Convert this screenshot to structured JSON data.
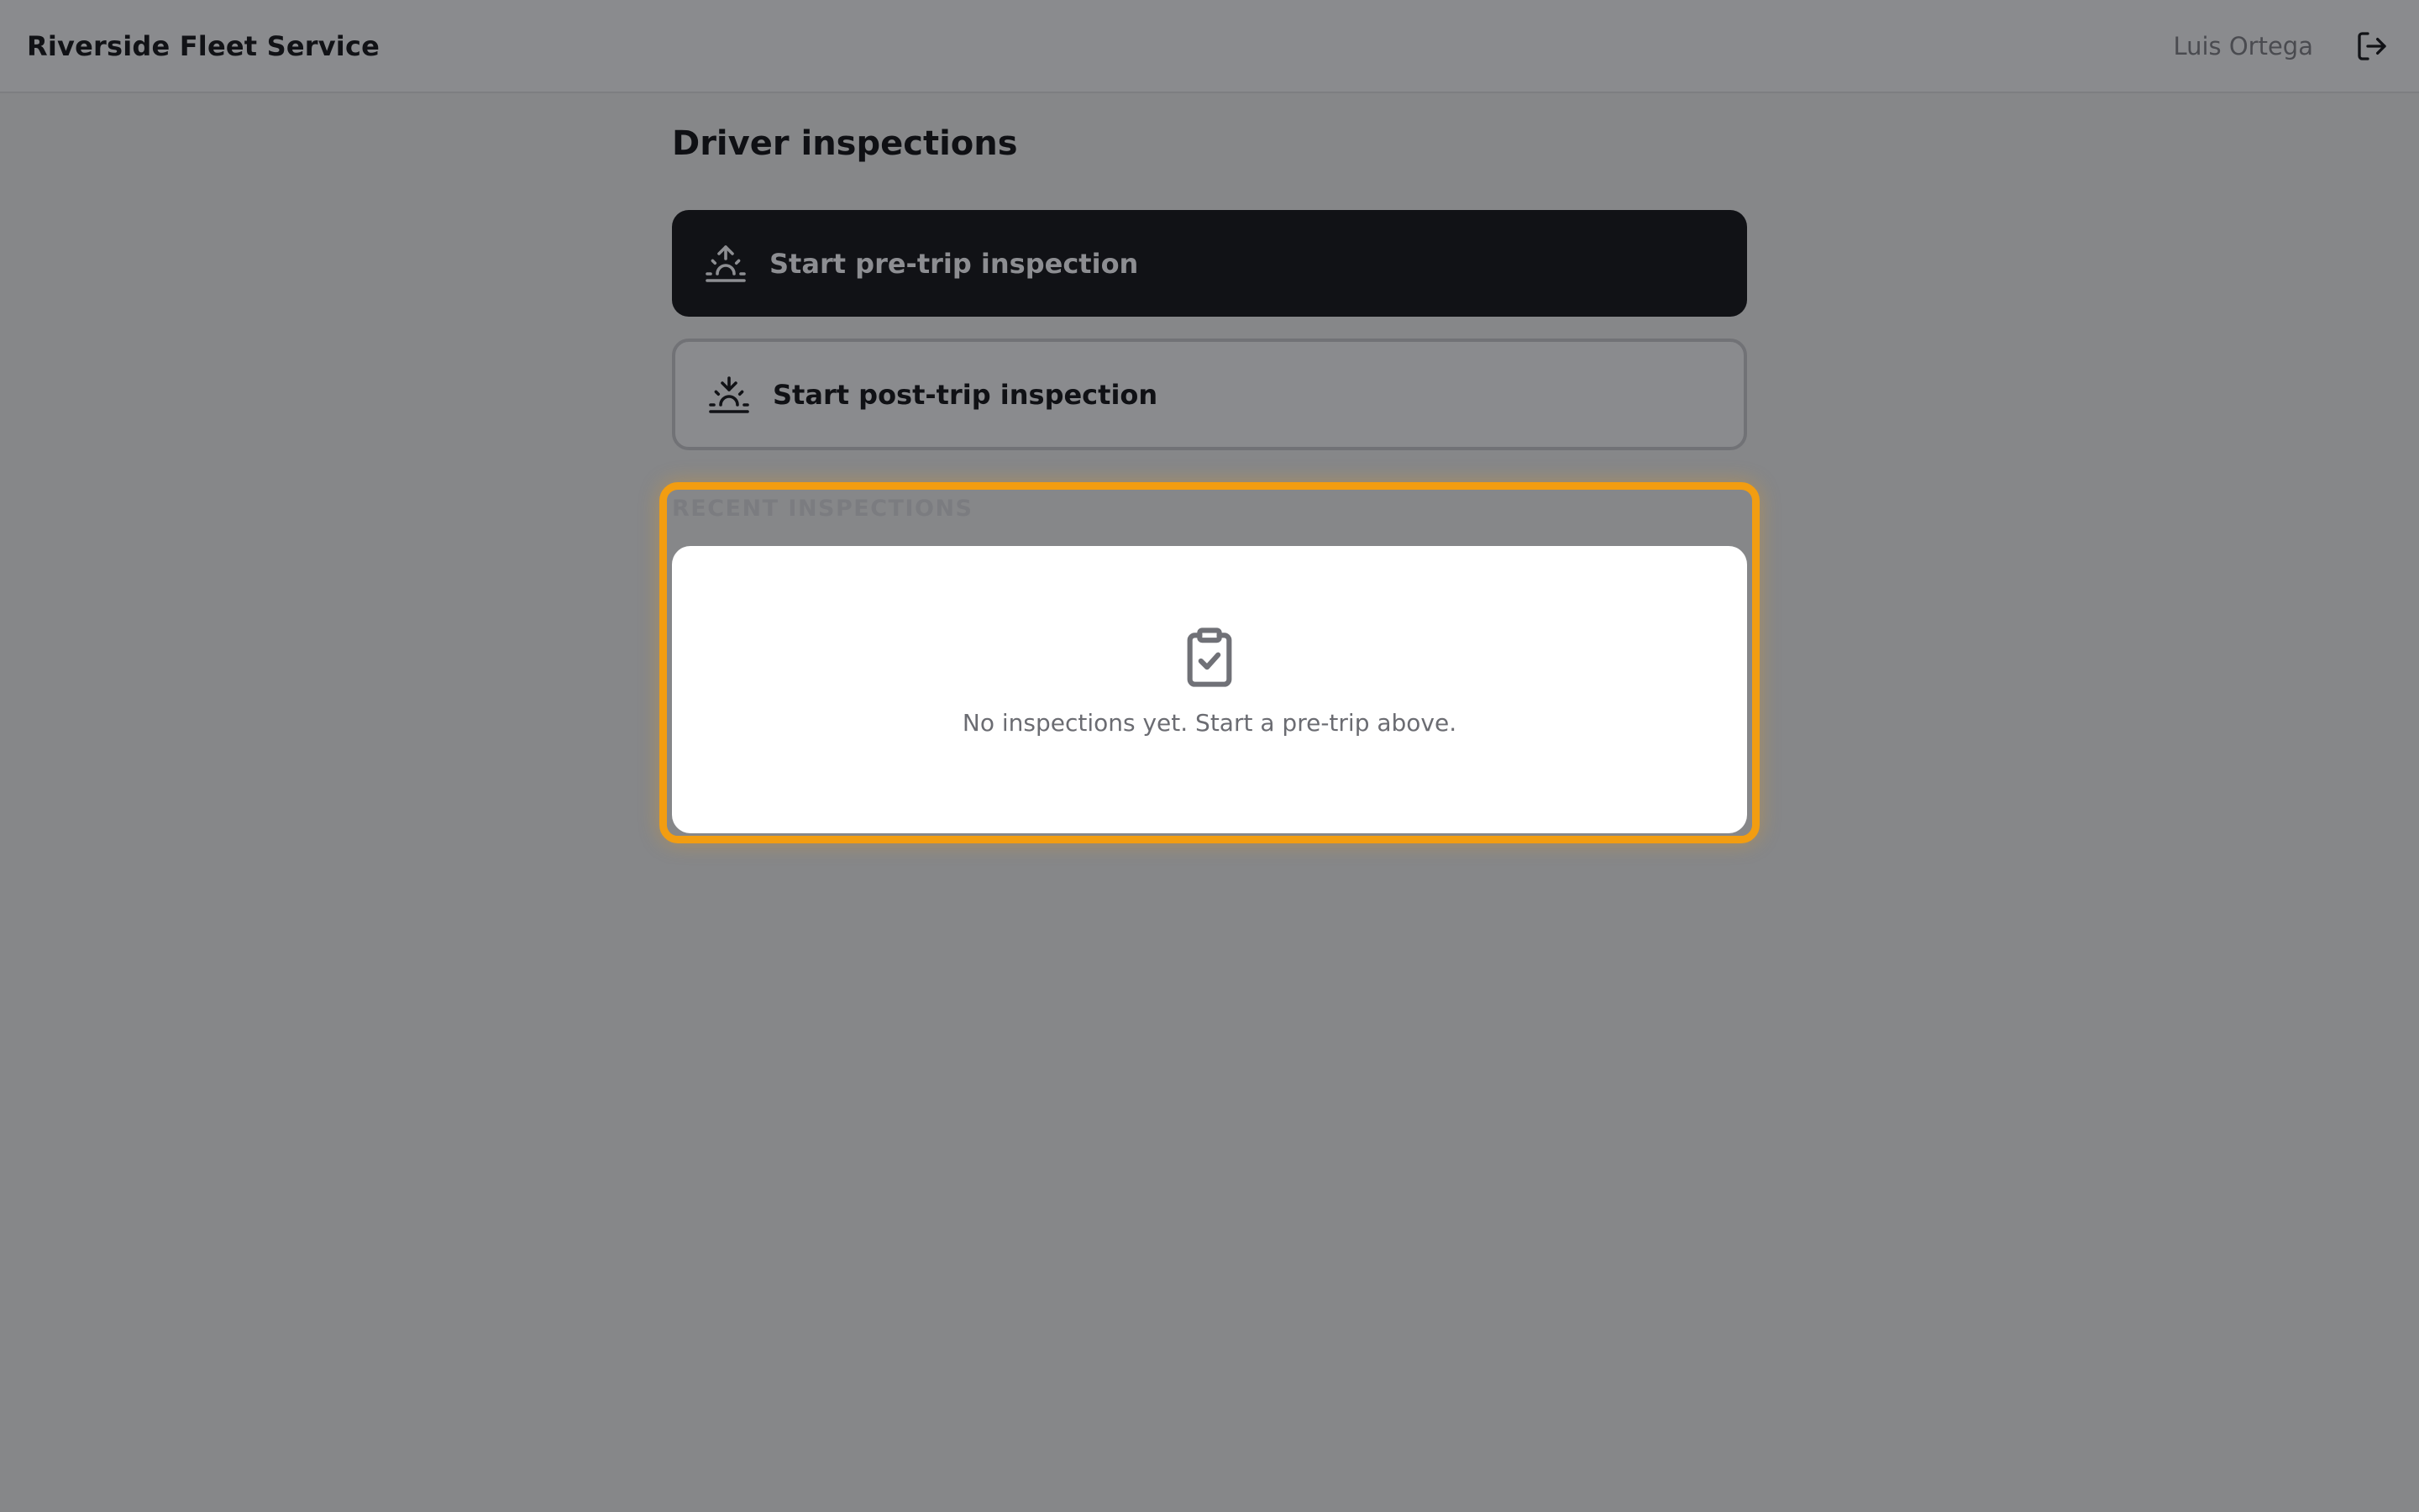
{
  "app": {
    "title": "Riverside Fleet Service"
  },
  "user": {
    "name": "Luis Ortega",
    "logout_icon": "logout-icon"
  },
  "page": {
    "title": "Driver inspections"
  },
  "actions": {
    "pre_trip_label": "Start pre-trip inspection",
    "pre_trip_icon": "sunrise-icon",
    "post_trip_label": "Start post-trip inspection",
    "post_trip_icon": "sunset-icon"
  },
  "recent": {
    "section_label": "RECENT INSPECTIONS",
    "empty_icon": "clipboard-check-icon",
    "empty_message": "No inspections yet. Start a pre-trip above."
  },
  "colors": {
    "highlight": "#f29d11",
    "primary_button": "#111216"
  }
}
